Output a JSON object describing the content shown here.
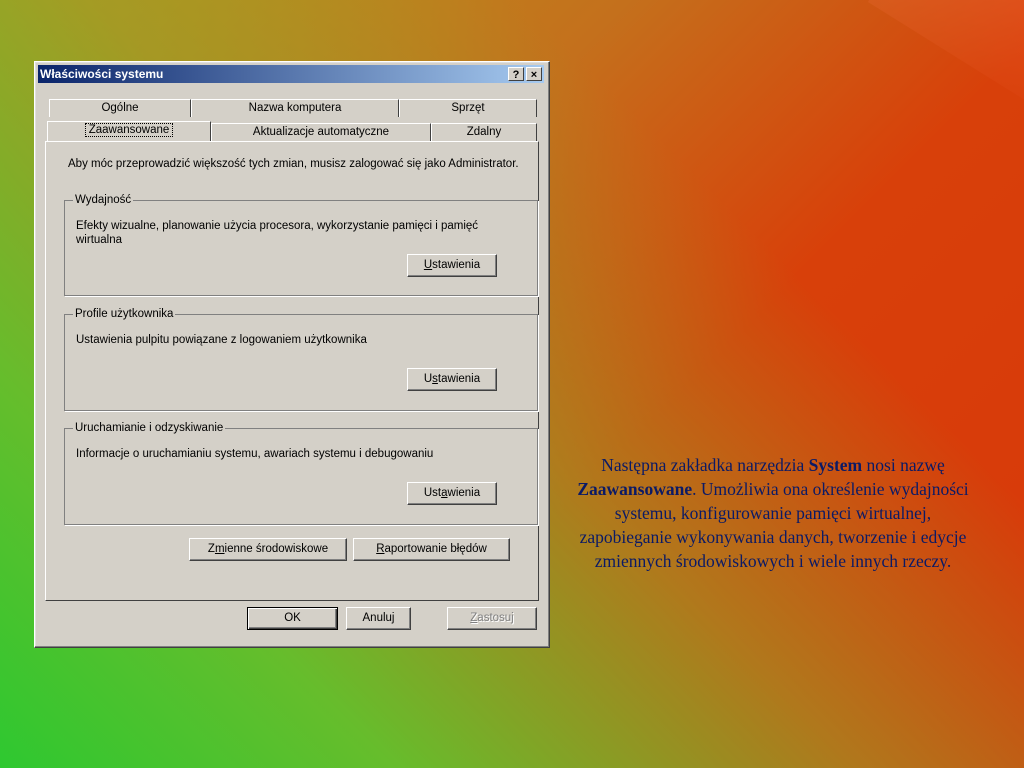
{
  "dialog": {
    "title": "Właściwości systemu",
    "help_label": "?",
    "close_label": "×",
    "tabs_row1": [
      "Ogólne",
      "Nazwa komputera",
      "Sprzęt"
    ],
    "tabs_row2": [
      "Zaawansowane",
      "Aktualizacje automatyczne",
      "Zdalny"
    ],
    "active_tab": "Zaawansowane",
    "intro": "Aby móc przeprowadzić większość tych zmian, musisz zalogować się jako Administrator.",
    "groups": [
      {
        "legend": "Wydajność",
        "description": "Efekty wizualne, planowanie użycia procesora, wykorzystanie pamięci i pamięć wirtualna",
        "button": {
          "pre": "",
          "accel": "U",
          "post": "stawienia"
        }
      },
      {
        "legend": "Profile użytkownika",
        "description": "Ustawienia pulpitu powiązane z logowaniem użytkownika",
        "button": {
          "pre": "U",
          "accel": "s",
          "post": "tawienia"
        }
      },
      {
        "legend": "Uruchamianie i odzyskiwanie",
        "description": "Informacje o uruchamianiu systemu, awariach systemu i debugowaniu",
        "button": {
          "pre": "Ust",
          "accel": "a",
          "post": "wienia"
        }
      }
    ],
    "env_button": {
      "pre": "Z",
      "accel": "m",
      "post": "ienne środowiskowe"
    },
    "error_button": {
      "pre": "",
      "accel": "R",
      "post": "aportowanie błędów"
    },
    "ok_label": "OK",
    "cancel_label": "Anuluj",
    "apply_button": {
      "pre": "",
      "accel": "Z",
      "post": "astosuj"
    }
  },
  "side_text": {
    "part1": "Następna zakładka narzędzia ",
    "bold1": "System",
    "part2": " nosi nazwę ",
    "bold2": "Zaawansowane",
    "part3": ". Umożliwia ona określenie wydajności systemu, konfigurowanie pamięci wirtualnej, zapobieganie wykonywania danych, tworzenie i edycje zmiennych środowiskowych i wiele innych rzeczy."
  }
}
